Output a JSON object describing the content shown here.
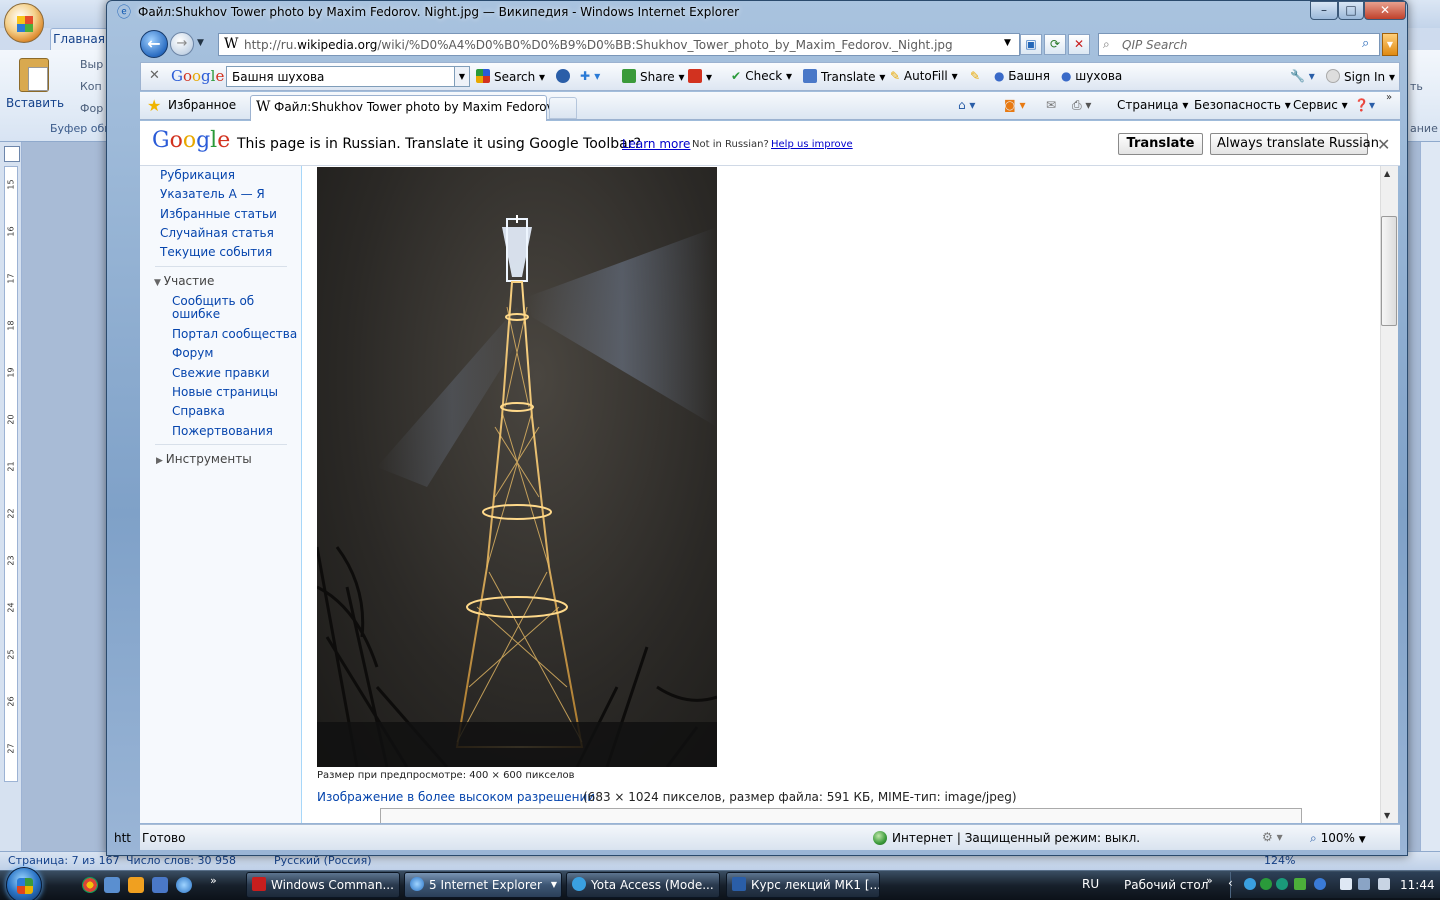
{
  "word": {
    "home_tab": "Главная",
    "paste_label": "Вставить",
    "cut_label": "Выр",
    "copy_label": "Коп",
    "format_painter_label": "Фор",
    "clipboard_group": "Буфер обм",
    "status_page": "Страница: 7 из 167",
    "status_words": "Число слов: 30 958",
    "status_lang": "Русский (Россия)",
    "zoom": "124%",
    "ruler_numbers": [
      "15",
      "16",
      "17",
      "18",
      "19",
      "20",
      "21",
      "22",
      "23",
      "24",
      "25",
      "26",
      "27"
    ],
    "right_partial_1": "ть",
    "right_partial_2": "ание"
  },
  "ie": {
    "window_title": "Файл:Shukhov Tower photo by Maxim Fedorov. Night.jpg — Википедия - Windows Internet Explorer",
    "address_prefix": "http://ru.",
    "address_domain": "wikipedia.org",
    "address_rest": "/wiki/%D0%A4%D0%B0%D0%B9%D0%BB:Shukhov_Tower_photo_by_Maxim_Fedorov._Night.jpg",
    "search_placeholder": "QIP Search",
    "tab_title": "Файл:Shukhov Tower photo by Maxim Fedorov. ...",
    "favorites_label": "Избранное",
    "commands": {
      "page": "Страница",
      "safety": "Безопасность",
      "tools": "Сервис"
    },
    "status_text": "Готово",
    "status_left_stub": "htt",
    "zone_text": "Интернет | Защищенный режим: выкл.",
    "zoom": "100%"
  },
  "google_toolbar": {
    "logo": [
      "G",
      "o",
      "o",
      "g",
      "l",
      "e"
    ],
    "query": "Башня шухова",
    "search": "Search",
    "share": "Share",
    "check": "Check",
    "translate": "Translate",
    "autofill": "AutoFill",
    "term1": "Башня",
    "term2": "шухова",
    "sign_in": "Sign In"
  },
  "translate_bar": {
    "message": "This page is in Russian.  Translate it using Google Toolbar?",
    "learn_more": "Learn more",
    "not_russian": "Not in Russian?",
    "help_improve": "Help us improve",
    "translate_btn": "Translate",
    "always_btn": "Always translate Russian"
  },
  "sidebar": {
    "nav_links": [
      "Рубрикация",
      "Указатель А — Я",
      "Избранные статьи",
      "Случайная статья",
      "Текущие события"
    ],
    "participation_head": "Участие",
    "participation_links": [
      "Сообщить об",
      "ошибке",
      "Портал сообщества",
      "Форум",
      "Свежие правки",
      "Новые страницы",
      "Справка",
      "Пожертвования"
    ],
    "tools_head": "Инструменты"
  },
  "page": {
    "preview_size": "Размер при предпросмотре: 400 × 600 пикселов",
    "hires_link": "Изображение в более высоком разрешении",
    "hires_info": "(683 × 1024 пикселов, размер файла: 591 КБ, MIME-тип: image/jpeg)"
  },
  "taskbar": {
    "tasks": [
      "Windows Comman...",
      "5 Internet Explorer",
      "Yota Access (Mode...",
      "Курс лекций МК1 [..."
    ],
    "language": "RU",
    "desktop": "Рабочий стол",
    "clock": "11:44"
  }
}
